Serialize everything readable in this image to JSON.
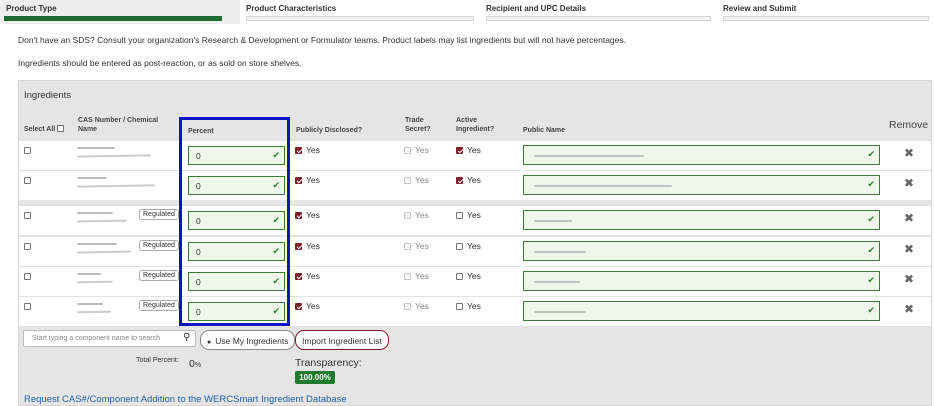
{
  "steps": [
    {
      "label": "Product Type",
      "active": true
    },
    {
      "label": "Product Characteristics",
      "active": false
    },
    {
      "label": "Recipient and UPC Details",
      "active": false
    },
    {
      "label": "Review and Submit",
      "active": false
    }
  ],
  "info": {
    "line1": "Don't have an SDS? Consult your organization's Research & Development or Formulator teams. Product labels may list ingredients but will not have percentages.",
    "line2": "Ingredients should be entered as post-reaction, or as sold on store shelves."
  },
  "ingredients": {
    "title": "Ingredients",
    "headers": {
      "select_all": "Select All",
      "cas": "CAS Number / Chemical Name",
      "percent": "Percent",
      "public": "Publicly Disclosed?",
      "trade": "Trade Secret?",
      "active": "Active Ingredient?",
      "public_name": "Public Name",
      "remove": "Remove"
    },
    "rows": [
      {
        "regulated": "",
        "percent": "0",
        "public_label": "Yes",
        "public_checked": true,
        "trade_label": "Yes",
        "active_label": "Yes",
        "active_checked": true
      },
      {
        "regulated": "",
        "percent": "0",
        "public_label": "Yes",
        "public_checked": true,
        "trade_label": "Yes",
        "active_label": "Yes",
        "active_checked": true
      },
      {
        "regulated": "Regulated",
        "percent": "0",
        "public_label": "Yes",
        "public_checked": true,
        "trade_label": "Yes",
        "active_label": "Yes",
        "active_checked": false
      },
      {
        "regulated": "Regulated",
        "percent": "0",
        "public_label": "Yes",
        "public_checked": true,
        "trade_label": "Yes",
        "active_label": "Yes",
        "active_checked": false
      },
      {
        "regulated": "Regulated",
        "percent": "0",
        "public_label": "Yes",
        "public_checked": true,
        "trade_label": "Yes",
        "active_label": "Yes",
        "active_checked": false
      },
      {
        "regulated": "Regulated",
        "percent": "0",
        "public_label": "Yes",
        "public_checked": true,
        "trade_label": "Yes",
        "active_label": "Yes",
        "active_checked": false
      }
    ],
    "search_placeholder": "Start typing a component name to search",
    "use_my_ingredients": "Use My Ingredients",
    "import_list": "Import Ingredient List",
    "total_label": "Total Percent:",
    "total_value": "0",
    "total_unit": "%",
    "transparency_label": "Transparency:",
    "transparency_value": "100.00%",
    "request_link": "Request CAS#/Component Addition to the WERCSmart Ingredient Database"
  },
  "icons": {
    "search": "search-icon",
    "user": "user-icon",
    "check": "check-icon",
    "remove": "remove-icon"
  },
  "colors": {
    "accent_green": "#1e6b2f",
    "accent_maroon": "#7a1f2b",
    "highlight_blue": "#0c14c8",
    "link_blue": "#1f5fa6"
  }
}
